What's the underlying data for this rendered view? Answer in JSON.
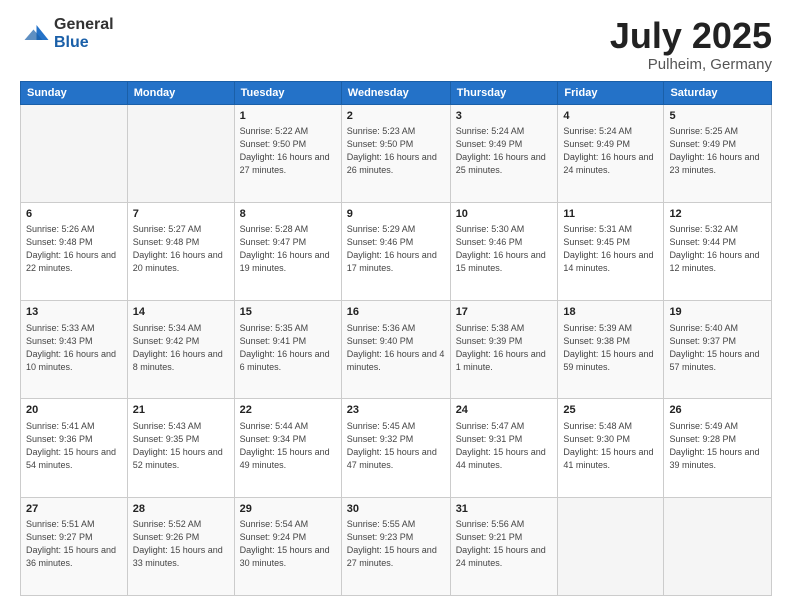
{
  "logo": {
    "general": "General",
    "blue": "Blue"
  },
  "header": {
    "month": "July 2025",
    "location": "Pulheim, Germany"
  },
  "weekdays": [
    "Sunday",
    "Monday",
    "Tuesday",
    "Wednesday",
    "Thursday",
    "Friday",
    "Saturday"
  ],
  "weeks": [
    [
      {
        "day": "",
        "detail": ""
      },
      {
        "day": "",
        "detail": ""
      },
      {
        "day": "1",
        "detail": "Sunrise: 5:22 AM\nSunset: 9:50 PM\nDaylight: 16 hours\nand 27 minutes."
      },
      {
        "day": "2",
        "detail": "Sunrise: 5:23 AM\nSunset: 9:50 PM\nDaylight: 16 hours\nand 26 minutes."
      },
      {
        "day": "3",
        "detail": "Sunrise: 5:24 AM\nSunset: 9:49 PM\nDaylight: 16 hours\nand 25 minutes."
      },
      {
        "day": "4",
        "detail": "Sunrise: 5:24 AM\nSunset: 9:49 PM\nDaylight: 16 hours\nand 24 minutes."
      },
      {
        "day": "5",
        "detail": "Sunrise: 5:25 AM\nSunset: 9:49 PM\nDaylight: 16 hours\nand 23 minutes."
      }
    ],
    [
      {
        "day": "6",
        "detail": "Sunrise: 5:26 AM\nSunset: 9:48 PM\nDaylight: 16 hours\nand 22 minutes."
      },
      {
        "day": "7",
        "detail": "Sunrise: 5:27 AM\nSunset: 9:48 PM\nDaylight: 16 hours\nand 20 minutes."
      },
      {
        "day": "8",
        "detail": "Sunrise: 5:28 AM\nSunset: 9:47 PM\nDaylight: 16 hours\nand 19 minutes."
      },
      {
        "day": "9",
        "detail": "Sunrise: 5:29 AM\nSunset: 9:46 PM\nDaylight: 16 hours\nand 17 minutes."
      },
      {
        "day": "10",
        "detail": "Sunrise: 5:30 AM\nSunset: 9:46 PM\nDaylight: 16 hours\nand 15 minutes."
      },
      {
        "day": "11",
        "detail": "Sunrise: 5:31 AM\nSunset: 9:45 PM\nDaylight: 16 hours\nand 14 minutes."
      },
      {
        "day": "12",
        "detail": "Sunrise: 5:32 AM\nSunset: 9:44 PM\nDaylight: 16 hours\nand 12 minutes."
      }
    ],
    [
      {
        "day": "13",
        "detail": "Sunrise: 5:33 AM\nSunset: 9:43 PM\nDaylight: 16 hours\nand 10 minutes."
      },
      {
        "day": "14",
        "detail": "Sunrise: 5:34 AM\nSunset: 9:42 PM\nDaylight: 16 hours\nand 8 minutes."
      },
      {
        "day": "15",
        "detail": "Sunrise: 5:35 AM\nSunset: 9:41 PM\nDaylight: 16 hours\nand 6 minutes."
      },
      {
        "day": "16",
        "detail": "Sunrise: 5:36 AM\nSunset: 9:40 PM\nDaylight: 16 hours\nand 4 minutes."
      },
      {
        "day": "17",
        "detail": "Sunrise: 5:38 AM\nSunset: 9:39 PM\nDaylight: 16 hours\nand 1 minute."
      },
      {
        "day": "18",
        "detail": "Sunrise: 5:39 AM\nSunset: 9:38 PM\nDaylight: 15 hours\nand 59 minutes."
      },
      {
        "day": "19",
        "detail": "Sunrise: 5:40 AM\nSunset: 9:37 PM\nDaylight: 15 hours\nand 57 minutes."
      }
    ],
    [
      {
        "day": "20",
        "detail": "Sunrise: 5:41 AM\nSunset: 9:36 PM\nDaylight: 15 hours\nand 54 minutes."
      },
      {
        "day": "21",
        "detail": "Sunrise: 5:43 AM\nSunset: 9:35 PM\nDaylight: 15 hours\nand 52 minutes."
      },
      {
        "day": "22",
        "detail": "Sunrise: 5:44 AM\nSunset: 9:34 PM\nDaylight: 15 hours\nand 49 minutes."
      },
      {
        "day": "23",
        "detail": "Sunrise: 5:45 AM\nSunset: 9:32 PM\nDaylight: 15 hours\nand 47 minutes."
      },
      {
        "day": "24",
        "detail": "Sunrise: 5:47 AM\nSunset: 9:31 PM\nDaylight: 15 hours\nand 44 minutes."
      },
      {
        "day": "25",
        "detail": "Sunrise: 5:48 AM\nSunset: 9:30 PM\nDaylight: 15 hours\nand 41 minutes."
      },
      {
        "day": "26",
        "detail": "Sunrise: 5:49 AM\nSunset: 9:28 PM\nDaylight: 15 hours\nand 39 minutes."
      }
    ],
    [
      {
        "day": "27",
        "detail": "Sunrise: 5:51 AM\nSunset: 9:27 PM\nDaylight: 15 hours\nand 36 minutes."
      },
      {
        "day": "28",
        "detail": "Sunrise: 5:52 AM\nSunset: 9:26 PM\nDaylight: 15 hours\nand 33 minutes."
      },
      {
        "day": "29",
        "detail": "Sunrise: 5:54 AM\nSunset: 9:24 PM\nDaylight: 15 hours\nand 30 minutes."
      },
      {
        "day": "30",
        "detail": "Sunrise: 5:55 AM\nSunset: 9:23 PM\nDaylight: 15 hours\nand 27 minutes."
      },
      {
        "day": "31",
        "detail": "Sunrise: 5:56 AM\nSunset: 9:21 PM\nDaylight: 15 hours\nand 24 minutes."
      },
      {
        "day": "",
        "detail": ""
      },
      {
        "day": "",
        "detail": ""
      }
    ]
  ]
}
